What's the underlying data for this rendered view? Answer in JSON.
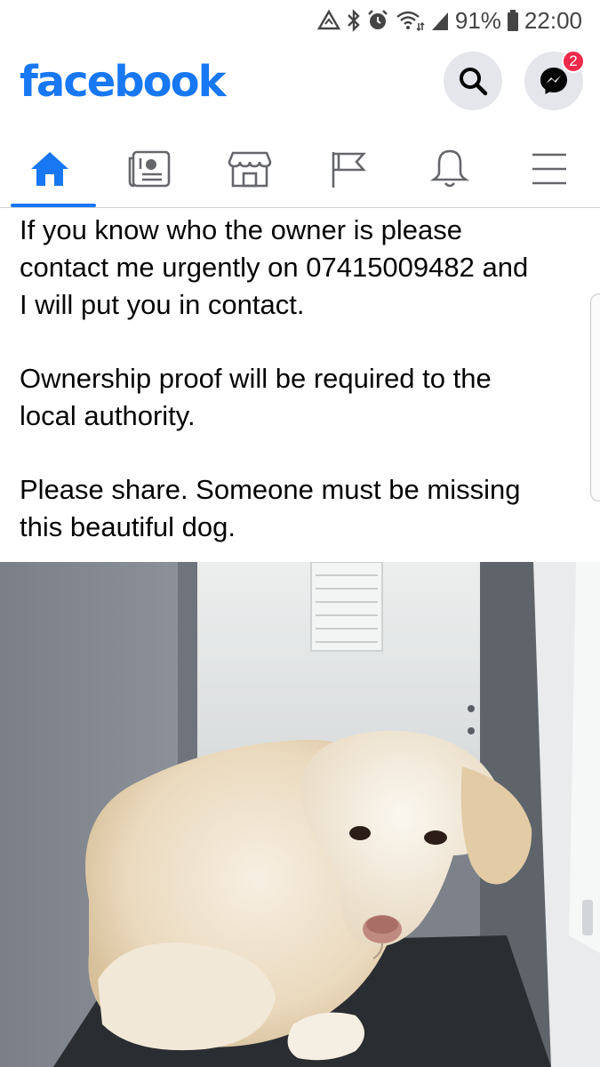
{
  "status_bar": {
    "battery": "91%",
    "time": "22:00",
    "icons": [
      "data-sync-icon",
      "bluetooth-icon",
      "alarm-icon",
      "wifi-icon",
      "signal-icon",
      "battery-icon"
    ]
  },
  "header": {
    "logo": "facebook",
    "messenger_badge": "2",
    "brand_color": "#1877f2",
    "badge_color": "#f02849"
  },
  "nav": {
    "tabs": [
      {
        "name": "home",
        "icon": "home-icon",
        "active": true
      },
      {
        "name": "news",
        "icon": "newspaper-icon",
        "active": false
      },
      {
        "name": "marketplace",
        "icon": "shop-icon",
        "active": false
      },
      {
        "name": "pages",
        "icon": "flag-icon",
        "active": false
      },
      {
        "name": "notifications",
        "icon": "bell-icon",
        "active": false
      },
      {
        "name": "menu",
        "icon": "hamburger-menu-icon",
        "active": false
      }
    ]
  },
  "post": {
    "paragraph_1_line_1": "If you know who the owner is please",
    "paragraph_1_line_2": "contact me urgently on 07415009482 and",
    "paragraph_1_line_3": "I will put you in contact.",
    "paragraph_2_line_1": "Ownership proof will be required to the",
    "paragraph_2_line_2": "local authority.",
    "paragraph_3_line_1": "Please share. Someone must be missing",
    "paragraph_3_line_2": "this beautiful dog."
  }
}
